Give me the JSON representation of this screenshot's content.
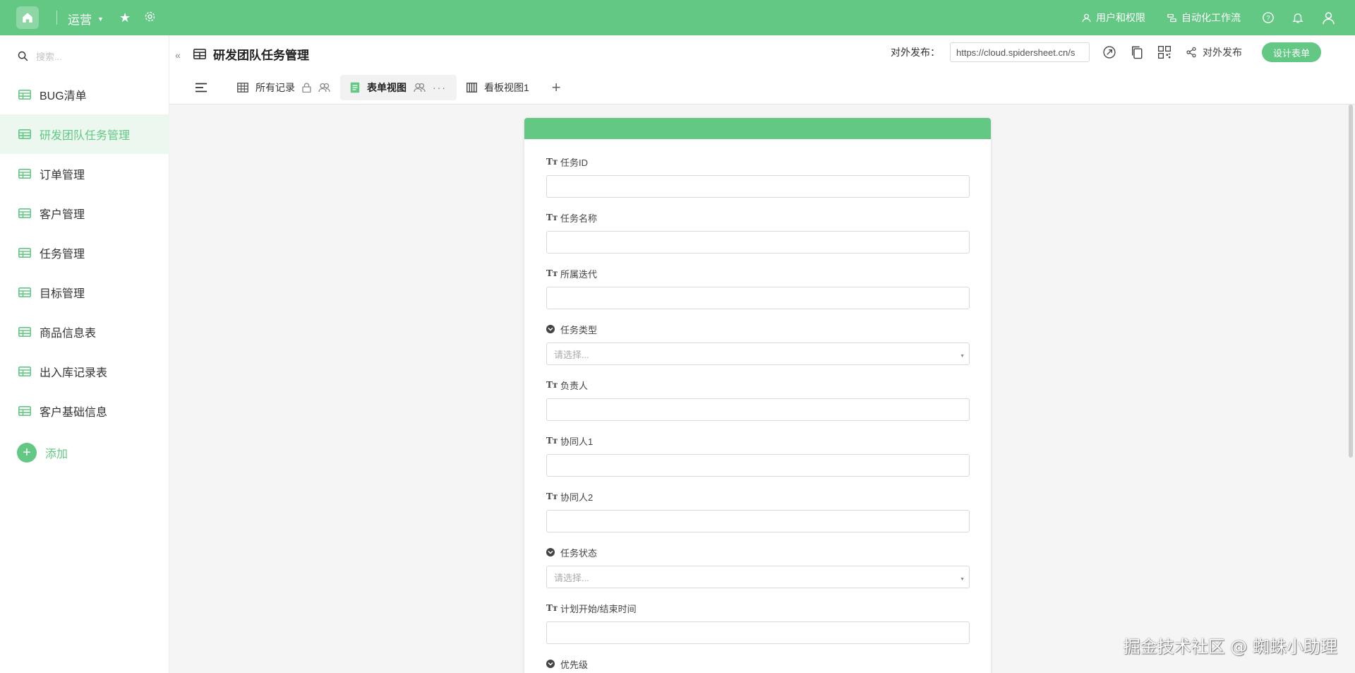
{
  "topbar": {
    "workspace": "运营",
    "links": [
      {
        "label": "用户和权限",
        "icon": "user-icon"
      },
      {
        "label": "自动化工作流",
        "icon": "workflow-icon"
      }
    ]
  },
  "sidebar": {
    "search_placeholder": "搜索...",
    "items": [
      {
        "label": "BUG清单",
        "active": false
      },
      {
        "label": "研发团队任务管理",
        "active": true
      },
      {
        "label": "订单管理",
        "active": false
      },
      {
        "label": "客户管理",
        "active": false
      },
      {
        "label": "任务管理",
        "active": false
      },
      {
        "label": "目标管理",
        "active": false
      },
      {
        "label": "商品信息表",
        "active": false
      },
      {
        "label": "出入库记录表",
        "active": false
      },
      {
        "label": "客户基础信息",
        "active": false
      }
    ],
    "add_label": "添加"
  },
  "header": {
    "title": "研发团队任务管理",
    "publish_label": "对外发布：",
    "publish_url": "https://cloud.spidersheet.cn/s",
    "share_label": "对外发布",
    "design_button": "设计表单"
  },
  "tabs": [
    {
      "label": "所有记录",
      "active": false
    },
    {
      "label": "表单视图",
      "active": true,
      "more": "···"
    },
    {
      "label": "看板视图1",
      "active": false
    }
  ],
  "form": {
    "fields": [
      {
        "label": "任务ID",
        "type": "text",
        "placeholder": ""
      },
      {
        "label": "任务名称",
        "type": "text",
        "placeholder": ""
      },
      {
        "label": "所属迭代",
        "type": "text",
        "placeholder": ""
      },
      {
        "label": "任务类型",
        "type": "select",
        "placeholder": "请选择..."
      },
      {
        "label": "负责人",
        "type": "text",
        "placeholder": ""
      },
      {
        "label": "协同人1",
        "type": "text",
        "placeholder": ""
      },
      {
        "label": "协同人2",
        "type": "text",
        "placeholder": ""
      },
      {
        "label": "任务状态",
        "type": "select",
        "placeholder": "请选择..."
      },
      {
        "label": "计划开始/结束时间",
        "type": "text",
        "placeholder": ""
      },
      {
        "label": "优先级",
        "type": "select",
        "placeholder": ""
      }
    ]
  },
  "watermark": "掘金技术社区 @ 蜘蛛小助理",
  "colors": {
    "accent": "#62c883",
    "active_bg": "#ebf7ef"
  }
}
